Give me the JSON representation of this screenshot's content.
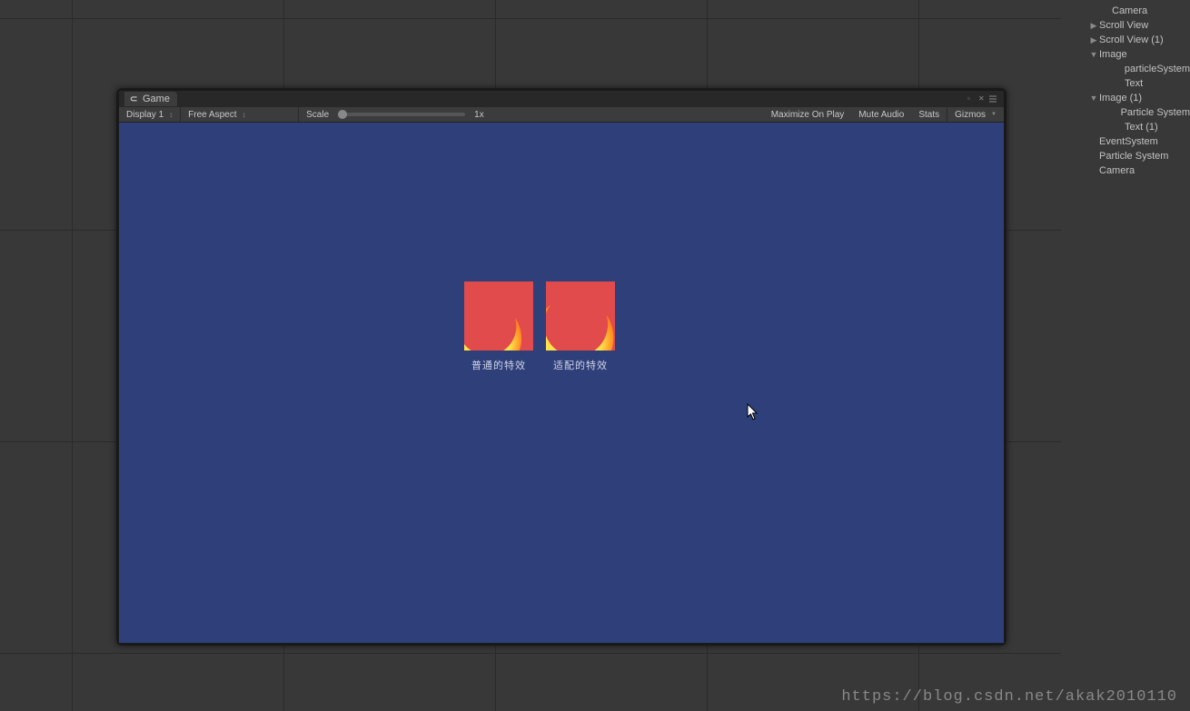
{
  "hierarchy": {
    "items": [
      {
        "indent": 44,
        "fold": "",
        "label": "Camera"
      },
      {
        "indent": 30,
        "fold": "▶",
        "label": "Scroll View"
      },
      {
        "indent": 30,
        "fold": "▶",
        "label": "Scroll View (1)"
      },
      {
        "indent": 30,
        "fold": "▼",
        "label": "Image"
      },
      {
        "indent": 58,
        "fold": "",
        "label": "particleSystem"
      },
      {
        "indent": 58,
        "fold": "",
        "label": "Text"
      },
      {
        "indent": 30,
        "fold": "▼",
        "label": "Image (1)"
      },
      {
        "indent": 58,
        "fold": "",
        "label": "Particle System"
      },
      {
        "indent": 58,
        "fold": "",
        "label": "Text (1)"
      },
      {
        "indent": 30,
        "fold": "",
        "label": "EventSystem"
      },
      {
        "indent": 30,
        "fold": "",
        "label": "Particle System"
      },
      {
        "indent": 30,
        "fold": "",
        "label": "Camera"
      }
    ]
  },
  "game_panel": {
    "tab_label": "Game",
    "toolbar": {
      "display": "Display 1",
      "aspect": "Free Aspect",
      "scale_label": "Scale",
      "scale_value": "1x",
      "maximize": "Maximize On Play",
      "mute": "Mute Audio",
      "stats": "Stats",
      "gizmos": "Gizmos"
    }
  },
  "demo": {
    "left_label": "普通的特效",
    "right_label": "适配的特效"
  },
  "watermark": "https://blog.csdn.net/akak2010110"
}
